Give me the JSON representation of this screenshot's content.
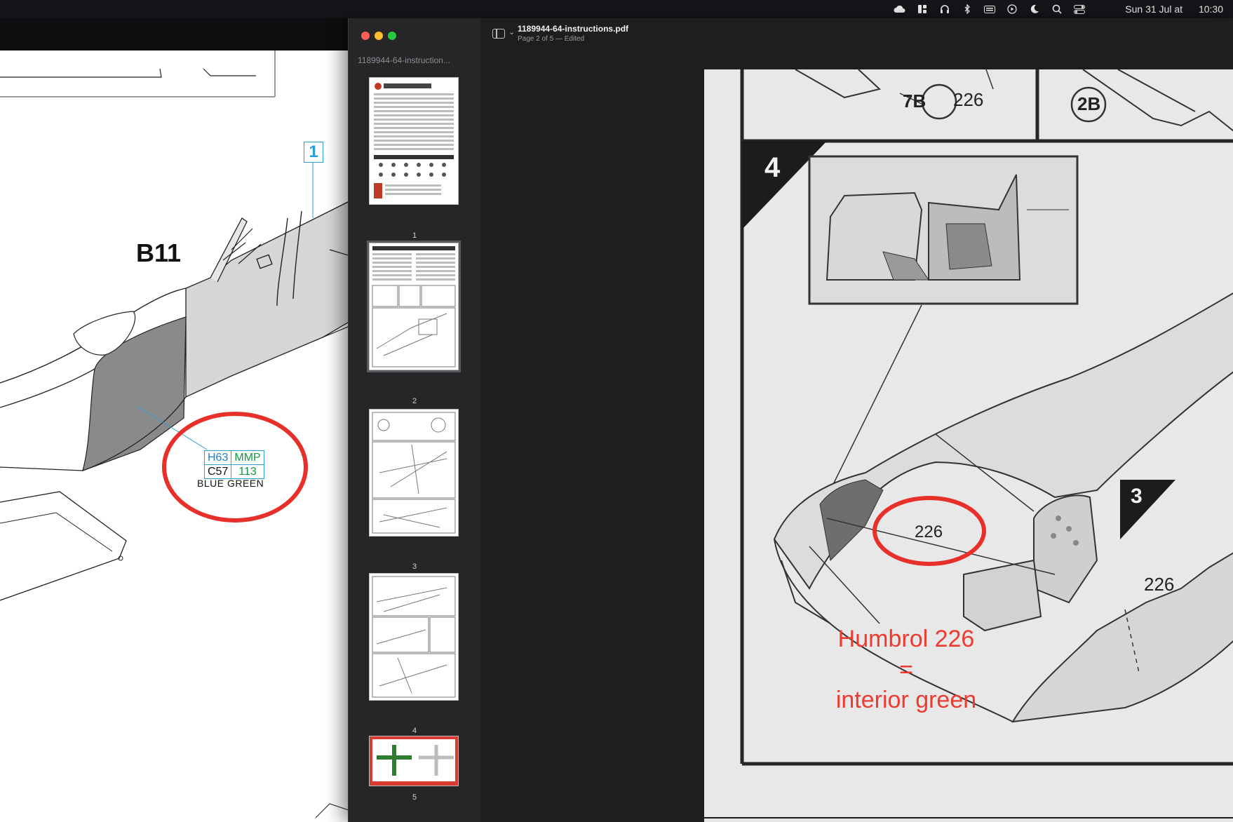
{
  "menubar": {
    "icons": [
      "cloud-icon",
      "window-tiling-icon",
      "headphones-icon",
      "bluetooth-icon",
      "keyboard-icon",
      "play-icon",
      "moon-icon",
      "search-icon",
      "control-center-icon"
    ],
    "date": "Sun 31 Jul at",
    "time": "10:30"
  },
  "background_doc": {
    "part_label": "B11",
    "step_number": "1",
    "paint": {
      "humbrol": "H63",
      "mmp": "MMP",
      "citadel": "C57",
      "mmp_code": "113",
      "name": "BLUE GREEN"
    },
    "colors": {
      "highlight_circle": "#e8302a",
      "callout": "#2a9fd6"
    }
  },
  "preview": {
    "sidebar_title": "1189944-64-instruction...",
    "file_name": "1189944-64-instructions.pdf",
    "subtitle": "Page 2 of 5 — Edited",
    "thumbnails": [
      {
        "number": "1"
      },
      {
        "number": "2"
      },
      {
        "number": "3"
      },
      {
        "number": "4"
      },
      {
        "number": "5"
      }
    ],
    "thumb1_heading": "1:72 Mitsubishi A6M2b 'Zero'",
    "page": {
      "labels": [
        "7B",
        "226",
        "2B",
        "4",
        "226",
        "3",
        "226"
      ],
      "annotation_line1": "Humbrol 226",
      "annotation_line2": "=",
      "annotation_line3": "interior green"
    }
  }
}
